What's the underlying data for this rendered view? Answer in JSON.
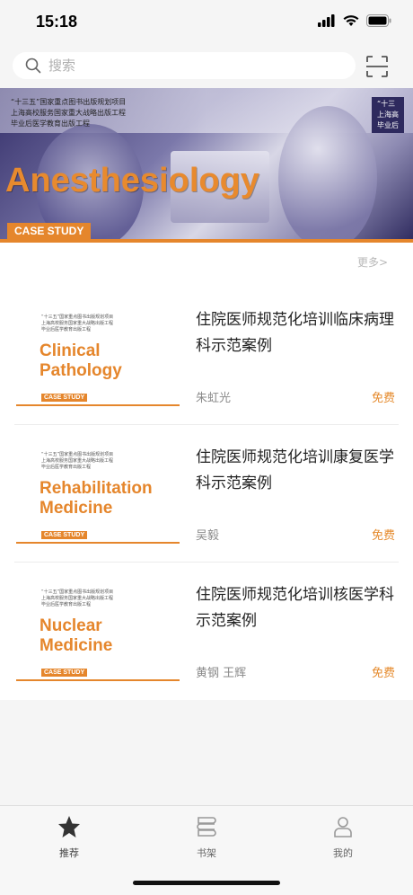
{
  "status_bar": {
    "time": "15:18"
  },
  "search": {
    "placeholder": "搜索"
  },
  "banner": {
    "title": "Anesthesiology",
    "case_label": "CASE STUDY",
    "top_left_text": "“十三五”国家重点图书出版规划项目\n上海高校服务国家重大战略出版工程\n毕业后医学教育出版工程",
    "top_right_text": "“十三\n上海高\n毕业后"
  },
  "more_link": "更多>",
  "books": [
    {
      "title": "住院医师规范化培训临床病理科示范案例",
      "cover_title_line1": "Clinical",
      "cover_title_line2": "Pathology",
      "cover_case": "CASE STUDY",
      "cover_small": "“十三五”国家重点图书出版规划项目\n上海高校服务国家重大战略出版工程\n毕业后医学教育出版工程",
      "author": "朱虹光",
      "price": "免费"
    },
    {
      "title": "住院医师规范化培训康复医学科示范案例",
      "cover_title_line1": "Rehabilitation",
      "cover_title_line2": "Medicine",
      "cover_case": "CASE STUDY",
      "cover_small": "“十三五”国家重点图书出版规划项目\n上海高校服务国家重大战略出版工程\n毕业后医学教育出版工程",
      "author": "吴毅",
      "price": "免费"
    },
    {
      "title": "住院医师规范化培训核医学科示范案例",
      "cover_title_line1": "Nuclear",
      "cover_title_line2": "Medicine",
      "cover_case": "CASE STUDY",
      "cover_small": "“十三五”国家重点图书出版规划项目\n上海高校服务国家重大战略出版工程\n毕业后医学教育出版工程",
      "author": "黄钢 王辉",
      "price": "免费"
    }
  ],
  "tabs": [
    {
      "label": "推荐",
      "icon": "star-icon"
    },
    {
      "label": "书架",
      "icon": "bookshelf-icon"
    },
    {
      "label": "我的",
      "icon": "person-icon"
    }
  ],
  "colors": {
    "accent": "#e5862c",
    "price": "#e58a2c"
  }
}
